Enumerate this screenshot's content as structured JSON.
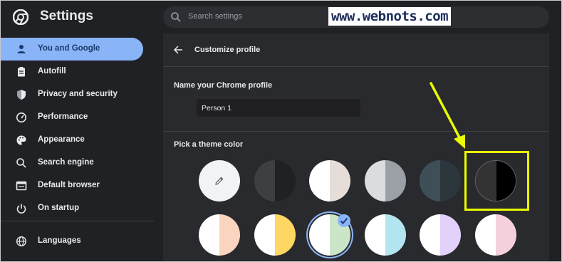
{
  "app": {
    "title": "Settings"
  },
  "search": {
    "placeholder": "Search settings"
  },
  "watermark": "www.webnots.com",
  "sidebar": {
    "items": [
      {
        "label": "You and Google",
        "icon": "person-icon",
        "active": true
      },
      {
        "label": "Autofill",
        "icon": "clipboard-icon",
        "active": false
      },
      {
        "label": "Privacy and security",
        "icon": "shield-icon",
        "active": false
      },
      {
        "label": "Performance",
        "icon": "speedometer-icon",
        "active": false
      },
      {
        "label": "Appearance",
        "icon": "palette-icon",
        "active": false
      },
      {
        "label": "Search engine",
        "icon": "search-icon",
        "active": false
      },
      {
        "label": "Default browser",
        "icon": "browser-window-icon",
        "active": false
      },
      {
        "label": "On startup",
        "icon": "power-icon",
        "active": false
      },
      {
        "label": "Languages",
        "icon": "globe-icon",
        "active": false
      }
    ]
  },
  "main": {
    "title": "Customize profile",
    "name_label": "Name your Chrome profile",
    "name_value": "Person 1",
    "theme_label": "Pick a theme color",
    "swatches_row1": [
      {
        "name": "custom-color-picker",
        "left": "#f1f3f4",
        "right": "#f1f3f4"
      },
      {
        "name": "grey-dark",
        "left": "#3c4043",
        "right": "#202124"
      },
      {
        "name": "beige",
        "left": "#ffffff",
        "right": "#e6ddd8"
      },
      {
        "name": "light-grey",
        "left": "#dadce0",
        "right": "#9aa0a6"
      },
      {
        "name": "blue-grey",
        "left": "#3f4f58",
        "right": "#2b363d"
      },
      {
        "name": "black",
        "left": "#333333",
        "right": "#000000"
      }
    ],
    "swatches_row2": [
      {
        "name": "peach",
        "left": "#ffffff",
        "right": "#fbd4bf"
      },
      {
        "name": "yellow",
        "left": "#ffffff",
        "right": "#fdd663"
      },
      {
        "name": "green",
        "left": "#ffffff",
        "right": "#cbe5c8",
        "selected": true
      },
      {
        "name": "light-blue",
        "left": "#ffffff",
        "right": "#b3e5f0"
      },
      {
        "name": "lavender",
        "left": "#ffffff",
        "right": "#e2d1fb"
      },
      {
        "name": "pink",
        "left": "#ffffff",
        "right": "#f4d0dc"
      }
    ]
  },
  "colors": {
    "accent": "#8ab4f8",
    "highlight": "#eaff00"
  }
}
